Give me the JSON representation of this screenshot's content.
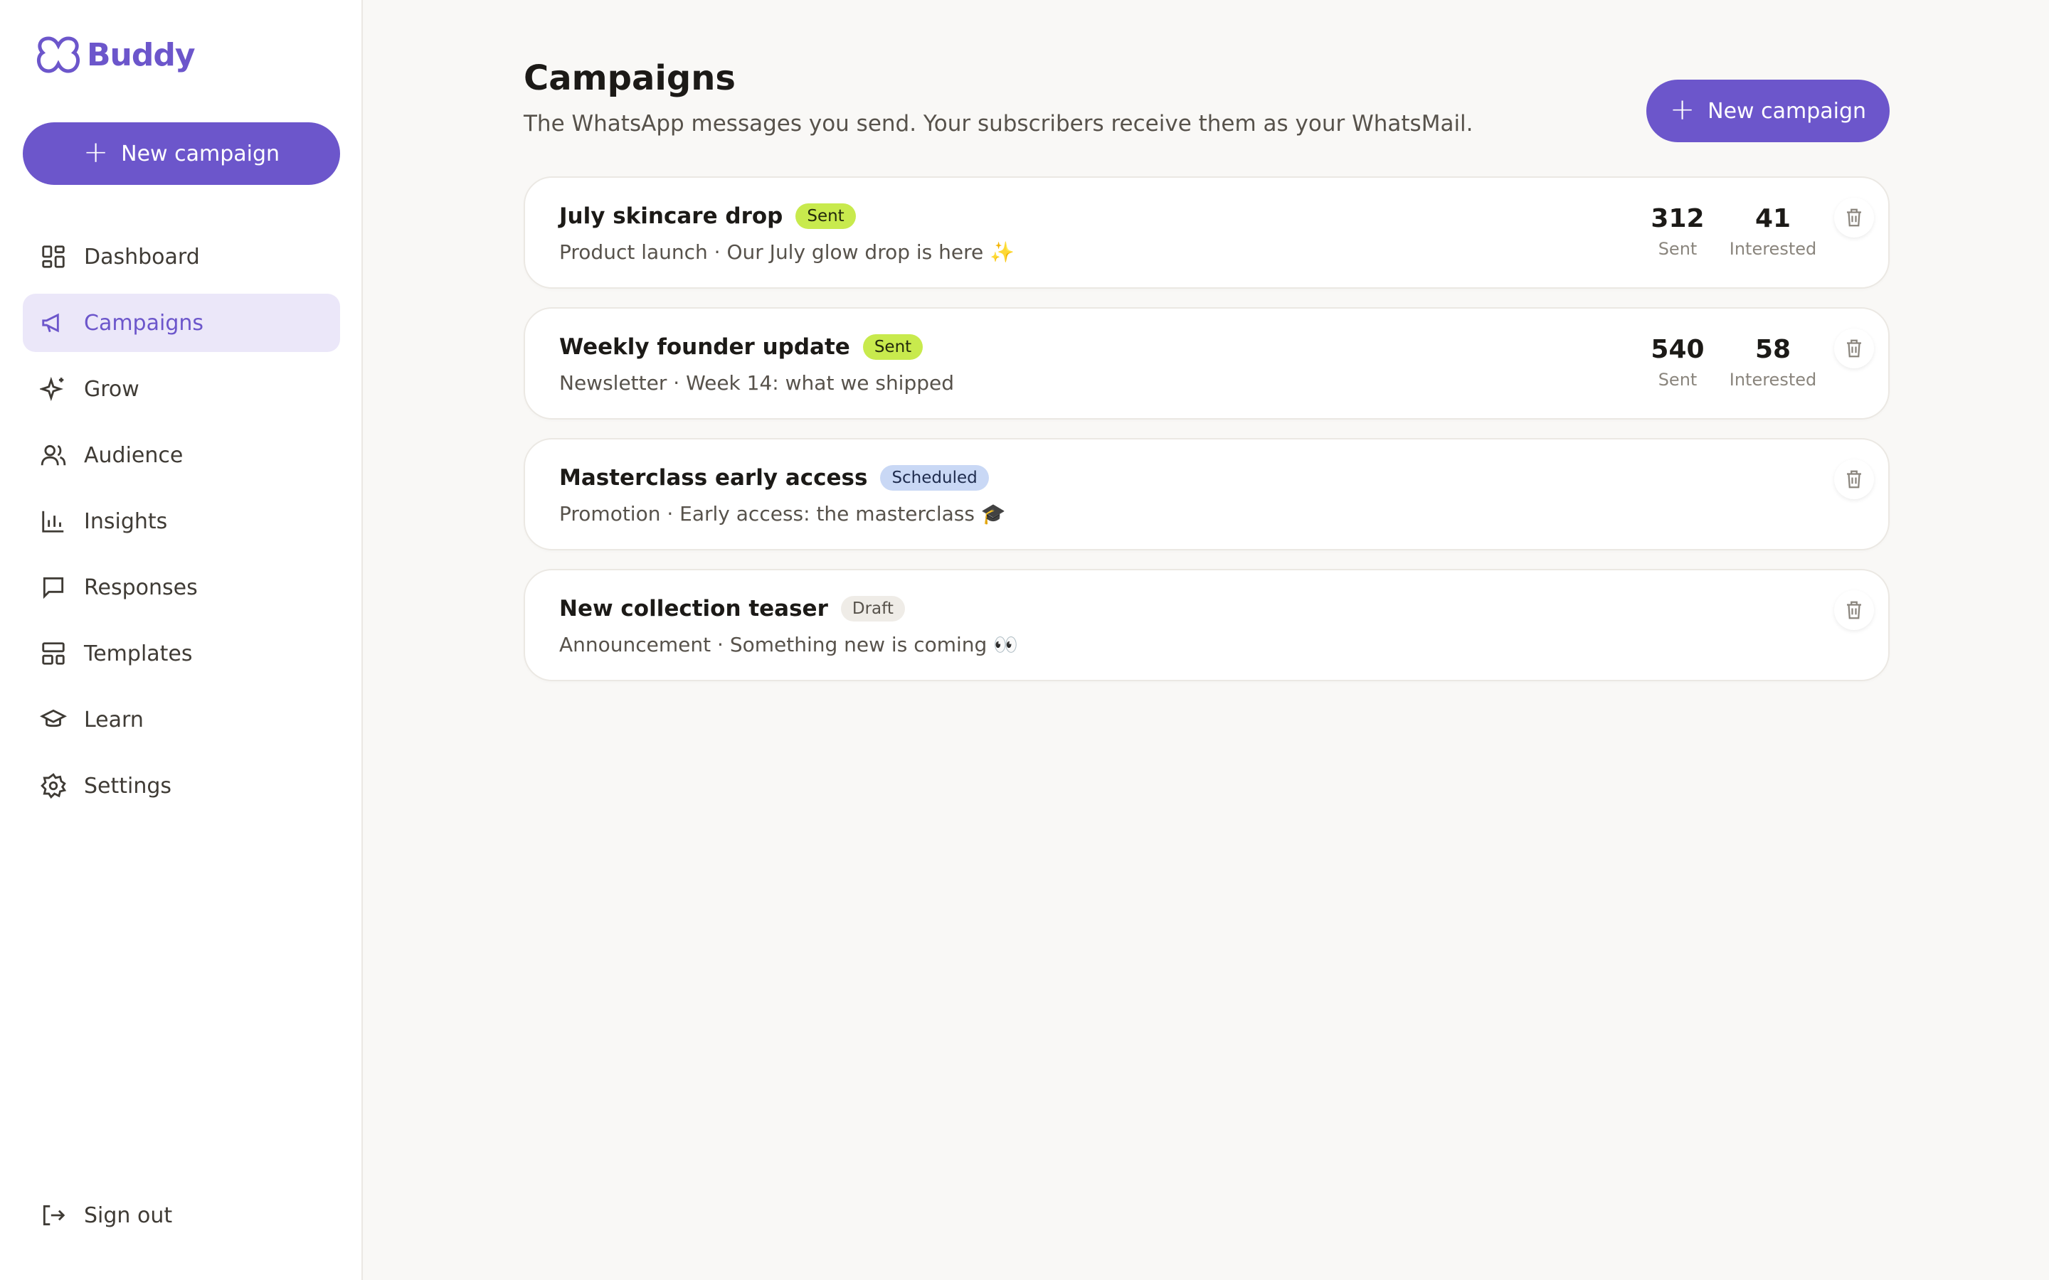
{
  "brand": {
    "name": "Buddy",
    "color": "#6c56cb"
  },
  "sidebar": {
    "new_campaign_label": "New campaign",
    "items": [
      {
        "label": "Dashboard",
        "icon": "dashboard-icon"
      },
      {
        "label": "Campaigns",
        "icon": "megaphone-icon",
        "active": true
      },
      {
        "label": "Grow",
        "icon": "sparkle-icon"
      },
      {
        "label": "Audience",
        "icon": "users-icon"
      },
      {
        "label": "Insights",
        "icon": "bar-chart-icon"
      },
      {
        "label": "Responses",
        "icon": "message-icon"
      },
      {
        "label": "Templates",
        "icon": "layout-icon"
      },
      {
        "label": "Learn",
        "icon": "graduation-cap-icon"
      },
      {
        "label": "Settings",
        "icon": "gear-icon"
      }
    ],
    "sign_out_label": "Sign out"
  },
  "main": {
    "title": "Campaigns",
    "subtitle": "The WhatsApp messages you send. Your subscribers receive them as your WhatsMail.",
    "new_campaign_label": "New campaign",
    "campaigns": [
      {
        "title": "July skincare drop",
        "status": "Sent",
        "subtitle": "Product launch · Our July glow drop is here ✨",
        "sent": "312",
        "sent_label": "Sent",
        "interested": "41",
        "interested_label": "Interested"
      },
      {
        "title": "Weekly founder update",
        "status": "Sent",
        "subtitle": "Newsletter · Week 14: what we shipped",
        "sent": "540",
        "sent_label": "Sent",
        "interested": "58",
        "interested_label": "Interested"
      },
      {
        "title": "Masterclass early access",
        "status": "Scheduled",
        "subtitle": "Promotion · Early access: the masterclass 🎓"
      },
      {
        "title": "New collection teaser",
        "status": "Draft",
        "subtitle": "Announcement · Something new is coming 👀"
      }
    ]
  }
}
